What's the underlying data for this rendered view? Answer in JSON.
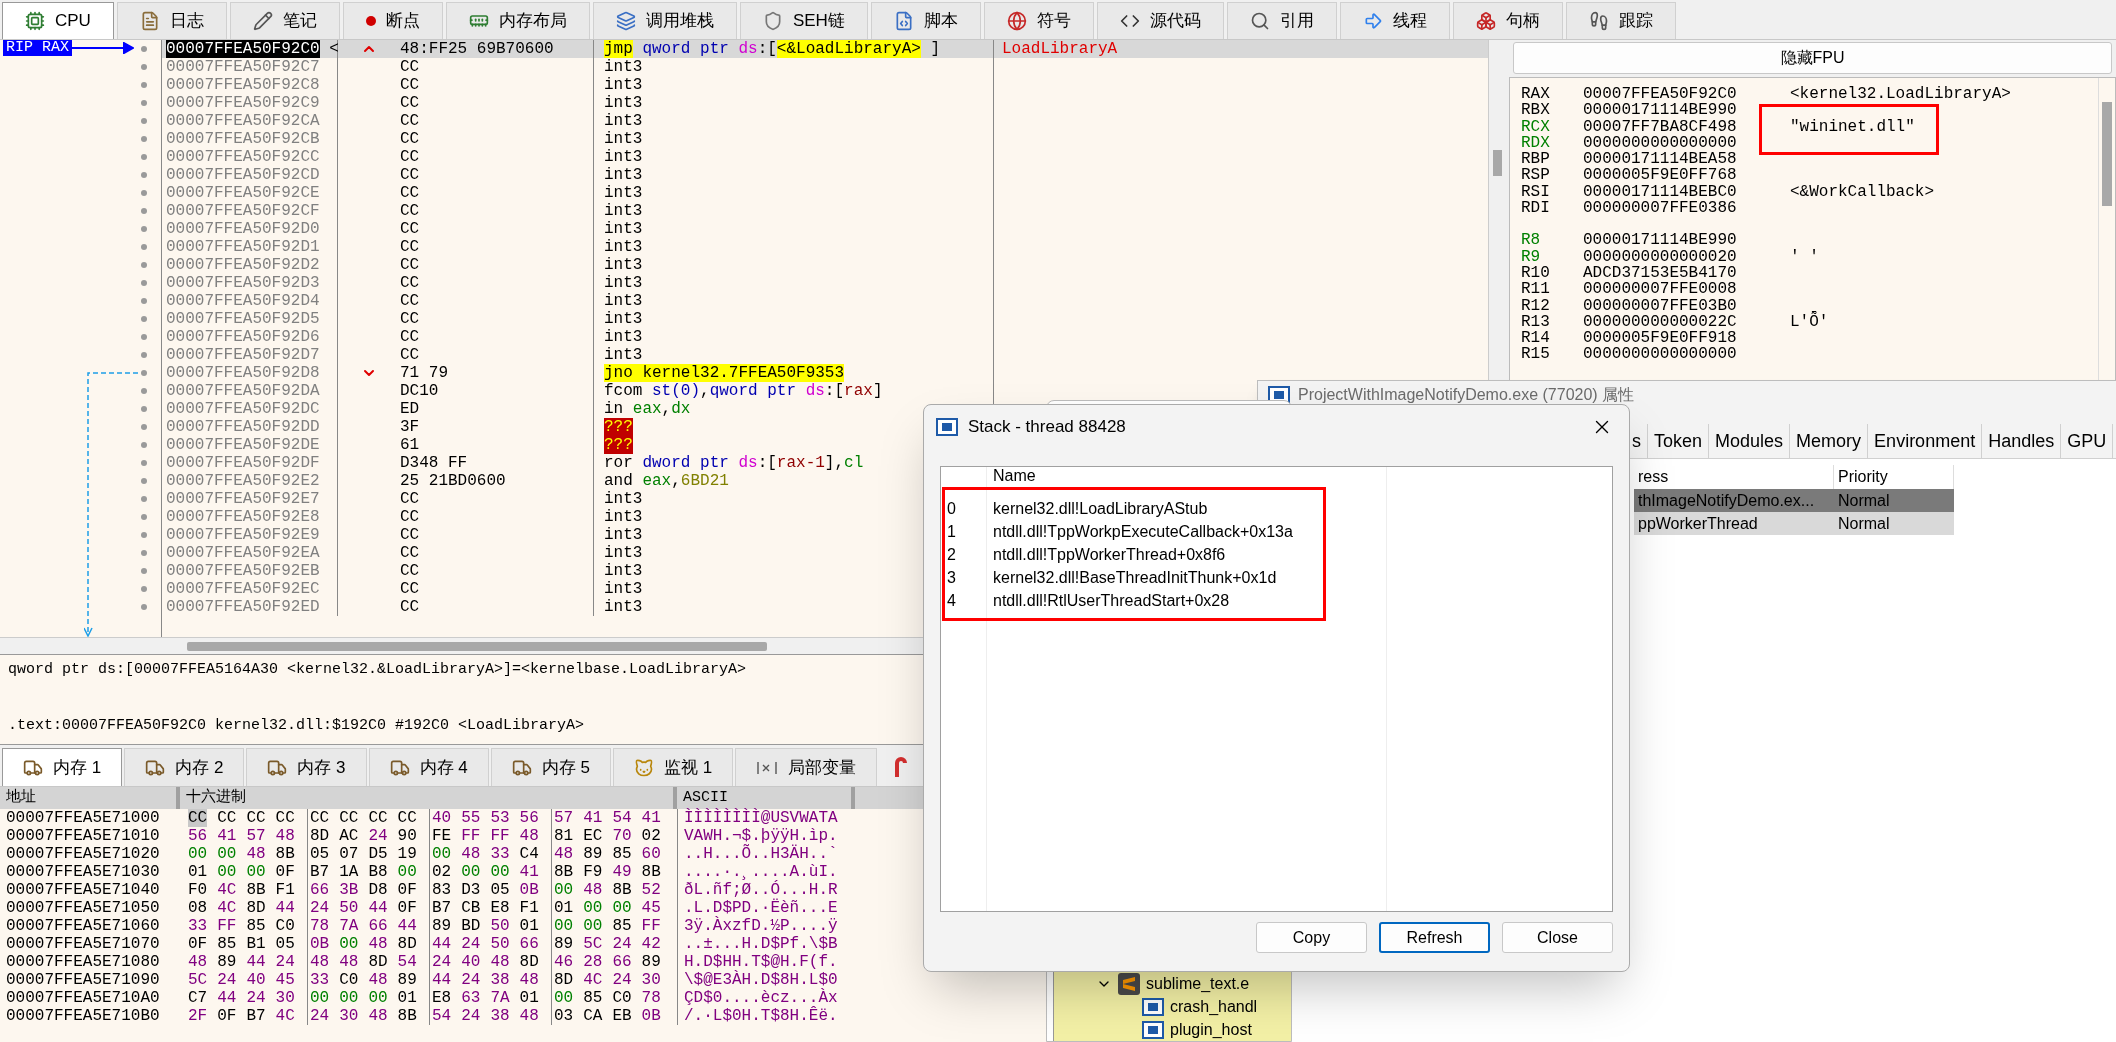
{
  "tabs": [
    {
      "label": "CPU",
      "selected": true
    },
    {
      "label": "日志",
      "selected": false
    },
    {
      "label": "笔记",
      "selected": false
    },
    {
      "label": "断点",
      "selected": false
    },
    {
      "label": "内存布局",
      "selected": false
    },
    {
      "label": "调用堆栈",
      "selected": false
    },
    {
      "label": "SEH链",
      "selected": false
    },
    {
      "label": "脚本",
      "selected": false
    },
    {
      "label": "符号",
      "selected": false
    },
    {
      "label": "源代码",
      "selected": false
    },
    {
      "label": "引用",
      "selected": false
    },
    {
      "label": "线程",
      "selected": false
    },
    {
      "label": "句柄",
      "selected": false
    },
    {
      "label": "跟踪",
      "selected": false
    }
  ],
  "disassembly": {
    "rip_label": "RIP RAX",
    "rows": [
      {
        "address": "00007FFEA50F92C0",
        "label": "<",
        "selected": true,
        "kind": "up",
        "bytes": "48:FF25 69B70600",
        "tokens": [
          {
            "text": "jmp",
            "kind": "jump"
          },
          {
            "text": " qword ptr",
            "kind": "ptr"
          },
          {
            "text": " ds",
            "kind": "seg"
          },
          {
            "text": ":[",
            "kind": "plain"
          },
          {
            "text": "<&LoadLibraryA>",
            "kind": "sym"
          },
          {
            "text": " ]",
            "kind": "plain"
          }
        ],
        "comment": "LoadLibraryA"
      },
      {
        "address": "00007FFEA50F92C7",
        "selected": false,
        "kind": "plain",
        "bytes": "CC",
        "tokens": [
          {
            "text": "int3",
            "kind": "plain"
          }
        ]
      },
      {
        "address": "00007FFEA50F92C8",
        "selected": false,
        "kind": "plain",
        "bytes": "CC",
        "tokens": [
          {
            "text": "int3",
            "kind": "plain"
          }
        ]
      },
      {
        "address": "00007FFEA50F92C9",
        "selected": false,
        "kind": "plain",
        "bytes": "CC",
        "tokens": [
          {
            "text": "int3",
            "kind": "plain"
          }
        ]
      },
      {
        "address": "00007FFEA50F92CA",
        "selected": false,
        "kind": "plain",
        "bytes": "CC",
        "tokens": [
          {
            "text": "int3",
            "kind": "plain"
          }
        ]
      },
      {
        "address": "00007FFEA50F92CB",
        "selected": false,
        "kind": "plain",
        "bytes": "CC",
        "tokens": [
          {
            "text": "int3",
            "kind": "plain"
          }
        ]
      },
      {
        "address": "00007FFEA50F92CC",
        "selected": false,
        "kind": "plain",
        "bytes": "CC",
        "tokens": [
          {
            "text": "int3",
            "kind": "plain"
          }
        ]
      },
      {
        "address": "00007FFEA50F92CD",
        "selected": false,
        "kind": "plain",
        "bytes": "CC",
        "tokens": [
          {
            "text": "int3",
            "kind": "plain"
          }
        ]
      },
      {
        "address": "00007FFEA50F92CE",
        "selected": false,
        "kind": "plain",
        "bytes": "CC",
        "tokens": [
          {
            "text": "int3",
            "kind": "plain"
          }
        ]
      },
      {
        "address": "00007FFEA50F92CF",
        "selected": false,
        "kind": "plain",
        "bytes": "CC",
        "tokens": [
          {
            "text": "int3",
            "kind": "plain"
          }
        ]
      },
      {
        "address": "00007FFEA50F92D0",
        "selected": false,
        "kind": "plain",
        "bytes": "CC",
        "tokens": [
          {
            "text": "int3",
            "kind": "plain"
          }
        ]
      },
      {
        "address": "00007FFEA50F92D1",
        "selected": false,
        "kind": "plain",
        "bytes": "CC",
        "tokens": [
          {
            "text": "int3",
            "kind": "plain"
          }
        ]
      },
      {
        "address": "00007FFEA50F92D2",
        "selected": false,
        "kind": "plain",
        "bytes": "CC",
        "tokens": [
          {
            "text": "int3",
            "kind": "plain"
          }
        ]
      },
      {
        "address": "00007FFEA50F92D3",
        "selected": false,
        "kind": "plain",
        "bytes": "CC",
        "tokens": [
          {
            "text": "int3",
            "kind": "plain"
          }
        ]
      },
      {
        "address": "00007FFEA50F92D4",
        "selected": false,
        "kind": "plain",
        "bytes": "CC",
        "tokens": [
          {
            "text": "int3",
            "kind": "plain"
          }
        ]
      },
      {
        "address": "00007FFEA50F92D5",
        "selected": false,
        "kind": "plain",
        "bytes": "CC",
        "tokens": [
          {
            "text": "int3",
            "kind": "plain"
          }
        ]
      },
      {
        "address": "00007FFEA50F92D6",
        "selected": false,
        "kind": "plain",
        "bytes": "CC",
        "tokens": [
          {
            "text": "int3",
            "kind": "plain"
          }
        ]
      },
      {
        "address": "00007FFEA50F92D7",
        "selected": false,
        "kind": "plain",
        "bytes": "CC",
        "tokens": [
          {
            "text": "int3",
            "kind": "plain"
          }
        ]
      },
      {
        "address": "00007FFEA50F92D8",
        "selected": false,
        "kind": "down",
        "bytes": "71 79",
        "tokens": [
          {
            "text": "jno",
            "kind": "jump"
          },
          {
            "text": " kernel32.7FFEA50F9353",
            "kind": "sym"
          }
        ]
      },
      {
        "address": "00007FFEA50F92DA",
        "selected": false,
        "kind": "plain",
        "bytes": "DC10",
        "tokens": [
          {
            "text": "fcom",
            "kind": "plain"
          },
          {
            "text": " st(0)",
            "kind": "ptr"
          },
          {
            "text": ",",
            "kind": "plain"
          },
          {
            "text": "qword ptr",
            "kind": "ptr"
          },
          {
            "text": " ds",
            "kind": "seg"
          },
          {
            "text": ":[",
            "kind": "plain"
          },
          {
            "text": "rax",
            "kind": "mem"
          },
          {
            "text": "]",
            "kind": "plain"
          }
        ]
      },
      {
        "address": "00007FFEA50F92DC",
        "selected": false,
        "kind": "plain",
        "bytes": "ED",
        "tokens": [
          {
            "text": "in",
            "kind": "plain"
          },
          {
            "text": " eax",
            "kind": "reg"
          },
          {
            "text": ",",
            "kind": "plain"
          },
          {
            "text": "dx",
            "kind": "reg"
          }
        ]
      },
      {
        "address": "00007FFEA50F92DD",
        "selected": false,
        "kind": "plain",
        "bytes": "3F",
        "tokens": [
          {
            "text": "???",
            "kind": "bad"
          }
        ]
      },
      {
        "address": "00007FFEA50F92DE",
        "selected": false,
        "kind": "plain",
        "bytes": "61",
        "tokens": [
          {
            "text": "???",
            "kind": "bad"
          }
        ]
      },
      {
        "address": "00007FFEA50F92DF",
        "selected": false,
        "kind": "plain",
        "bytes": "D348 FF",
        "tokens": [
          {
            "text": "ror",
            "kind": "plain"
          },
          {
            "text": " dword ptr",
            "kind": "ptr"
          },
          {
            "text": " ds",
            "kind": "seg"
          },
          {
            "text": ":[",
            "kind": "plain"
          },
          {
            "text": "rax-1",
            "kind": "mem"
          },
          {
            "text": "],",
            "kind": "plain"
          },
          {
            "text": "cl",
            "kind": "reg"
          }
        ]
      },
      {
        "address": "00007FFEA50F92E2",
        "selected": false,
        "kind": "plain",
        "bytes": "25 21BD0600",
        "tokens": [
          {
            "text": "and",
            "kind": "plain"
          },
          {
            "text": " eax",
            "kind": "reg"
          },
          {
            "text": ",",
            "kind": "plain"
          },
          {
            "text": "6BD21",
            "kind": "imm"
          }
        ]
      },
      {
        "address": "00007FFEA50F92E7",
        "selected": false,
        "kind": "plain",
        "bytes": "CC",
        "tokens": [
          {
            "text": "int3",
            "kind": "plain"
          }
        ]
      },
      {
        "address": "00007FFEA50F92E8",
        "selected": false,
        "kind": "plain",
        "bytes": "CC",
        "tokens": [
          {
            "text": "int3",
            "kind": "plain"
          }
        ]
      },
      {
        "address": "00007FFEA50F92E9",
        "selected": false,
        "kind": "plain",
        "bytes": "CC",
        "tokens": [
          {
            "text": "int3",
            "kind": "plain"
          }
        ]
      },
      {
        "address": "00007FFEA50F92EA",
        "selected": false,
        "kind": "plain",
        "bytes": "CC",
        "tokens": [
          {
            "text": "int3",
            "kind": "plain"
          }
        ]
      },
      {
        "address": "00007FFEA50F92EB",
        "selected": false,
        "kind": "plain",
        "bytes": "CC",
        "tokens": [
          {
            "text": "int3",
            "kind": "plain"
          }
        ]
      },
      {
        "address": "00007FFEA50F92EC",
        "selected": false,
        "kind": "plain",
        "bytes": "CC",
        "tokens": [
          {
            "text": "int3",
            "kind": "plain"
          }
        ]
      },
      {
        "address": "00007FFEA50F92ED",
        "selected": false,
        "kind": "plain",
        "bytes": "CC",
        "tokens": [
          {
            "text": "int3",
            "kind": "plain"
          }
        ]
      }
    ]
  },
  "info": {
    "lines": [
      "qword ptr ds:[00007FFEA5164A30 <kernel32.&LoadLibraryA>]=<kernelbase.LoadLibraryA>",
      ".text:00007FFEA50F92C0 kernel32.dll:$192C0 #192C0 <LoadLibraryA>"
    ]
  },
  "memory_tabs": [
    {
      "label": "内存 1",
      "selected": true
    },
    {
      "label": "内存 2",
      "selected": false
    },
    {
      "label": "内存 3",
      "selected": false
    },
    {
      "label": "内存 4",
      "selected": false
    },
    {
      "label": "内存 5",
      "selected": false
    },
    {
      "label": "监视 1",
      "selected": false
    },
    {
      "label": "局部变量",
      "selected": false
    }
  ],
  "hex": {
    "columns": [
      "地址",
      "十六进制",
      "ASCII"
    ],
    "rows": [
      {
        "address": "00007FFEA5E71000",
        "bytes": [
          {
            "text": "CC",
            "kind": "other"
          },
          {
            "text": "CC",
            "kind": "other"
          },
          {
            "text": "CC",
            "kind": "other"
          },
          {
            "text": "CC",
            "kind": "other"
          },
          {
            "text": "CC",
            "kind": "other"
          },
          {
            "text": "CC",
            "kind": "other"
          },
          {
            "text": "CC",
            "kind": "other"
          },
          {
            "text": "CC",
            "kind": "other"
          },
          {
            "text": "40",
            "kind": "ascii"
          },
          {
            "text": "55",
            "kind": "ascii"
          },
          {
            "text": "53",
            "kind": "ascii"
          },
          {
            "text": "56",
            "kind": "ascii"
          },
          {
            "text": "57",
            "kind": "ascii"
          },
          {
            "text": "41",
            "kind": "ascii"
          },
          {
            "text": "54",
            "kind": "ascii"
          },
          {
            "text": "41",
            "kind": "ascii"
          }
        ],
        "ascii": "ÌÌÌÌÌÌÌÌ@USVWATA"
      },
      {
        "address": "00007FFEA5E71010",
        "bytes": [
          {
            "text": "56",
            "kind": "ascii"
          },
          {
            "text": "41",
            "kind": "ascii"
          },
          {
            "text": "57",
            "kind": "ascii"
          },
          {
            "text": "48",
            "kind": "ascii"
          },
          {
            "text": "8D",
            "kind": "other"
          },
          {
            "text": "AC",
            "kind": "other"
          },
          {
            "text": "24",
            "kind": "ascii"
          },
          {
            "text": "90",
            "kind": "other"
          },
          {
            "text": "FE",
            "kind": "other"
          },
          {
            "text": "FF",
            "kind": "ascii"
          },
          {
            "text": "FF",
            "kind": "ascii"
          },
          {
            "text": "48",
            "kind": "ascii"
          },
          {
            "text": "81",
            "kind": "other"
          },
          {
            "text": "EC",
            "kind": "other"
          },
          {
            "text": "70",
            "kind": "ascii"
          },
          {
            "text": "02",
            "kind": "other"
          }
        ],
        "ascii": "VAWH.¬$.þÿÿH.ìp."
      },
      {
        "address": "00007FFEA5E71020",
        "bytes": [
          {
            "text": "00",
            "kind": "zero"
          },
          {
            "text": "00",
            "kind": "zero"
          },
          {
            "text": "48",
            "kind": "ascii"
          },
          {
            "text": "8B",
            "kind": "other"
          },
          {
            "text": "05",
            "kind": "other"
          },
          {
            "text": "07",
            "kind": "other"
          },
          {
            "text": "D5",
            "kind": "other"
          },
          {
            "text": "19",
            "kind": "other"
          },
          {
            "text": "00",
            "kind": "zero"
          },
          {
            "text": "48",
            "kind": "ascii"
          },
          {
            "text": "33",
            "kind": "ascii"
          },
          {
            "text": "C4",
            "kind": "other"
          },
          {
            "text": "48",
            "kind": "ascii"
          },
          {
            "text": "89",
            "kind": "other"
          },
          {
            "text": "85",
            "kind": "other"
          },
          {
            "text": "60",
            "kind": "ascii"
          }
        ],
        "ascii": "..H...Õ..H3ÄH..`"
      },
      {
        "address": "00007FFEA5E71030",
        "bytes": [
          {
            "text": "01",
            "kind": "other"
          },
          {
            "text": "00",
            "kind": "zero"
          },
          {
            "text": "00",
            "kind": "zero"
          },
          {
            "text": "0F",
            "kind": "other"
          },
          {
            "text": "B7",
            "kind": "other"
          },
          {
            "text": "1A",
            "kind": "other"
          },
          {
            "text": "B8",
            "kind": "other"
          },
          {
            "text": "00",
            "kind": "zero"
          },
          {
            "text": "02",
            "kind": "other"
          },
          {
            "text": "00",
            "kind": "zero"
          },
          {
            "text": "00",
            "kind": "zero"
          },
          {
            "text": "41",
            "kind": "ascii"
          },
          {
            "text": "8B",
            "kind": "other"
          },
          {
            "text": "F9",
            "kind": "other"
          },
          {
            "text": "49",
            "kind": "ascii"
          },
          {
            "text": "8B",
            "kind": "other"
          }
        ],
        "ascii": "....·.¸....A.ùI."
      },
      {
        "address": "00007FFEA5E71040",
        "bytes": [
          {
            "text": "F0",
            "kind": "other"
          },
          {
            "text": "4C",
            "kind": "ascii"
          },
          {
            "text": "8B",
            "kind": "other"
          },
          {
            "text": "F1",
            "kind": "other"
          },
          {
            "text": "66",
            "kind": "ascii"
          },
          {
            "text": "3B",
            "kind": "ascii"
          },
          {
            "text": "D8",
            "kind": "other"
          },
          {
            "text": "0F",
            "kind": "other"
          },
          {
            "text": "83",
            "kind": "other"
          },
          {
            "text": "D3",
            "kind": "other"
          },
          {
            "text": "05",
            "kind": "other"
          },
          {
            "text": "0B",
            "kind": "ascii"
          },
          {
            "text": "00",
            "kind": "zero"
          },
          {
            "text": "48",
            "kind": "ascii"
          },
          {
            "text": "8B",
            "kind": "other"
          },
          {
            "text": "52",
            "kind": "ascii"
          }
        ],
        "ascii": "ðL.ñf;Ø..Ó...H.R"
      },
      {
        "address": "00007FFEA5E71050",
        "bytes": [
          {
            "text": "08",
            "kind": "other"
          },
          {
            "text": "4C",
            "kind": "ascii"
          },
          {
            "text": "8D",
            "kind": "other"
          },
          {
            "text": "44",
            "kind": "ascii"
          },
          {
            "text": "24",
            "kind": "ascii"
          },
          {
            "text": "50",
            "kind": "ascii"
          },
          {
            "text": "44",
            "kind": "ascii"
          },
          {
            "text": "0F",
            "kind": "other"
          },
          {
            "text": "B7",
            "kind": "other"
          },
          {
            "text": "CB",
            "kind": "other"
          },
          {
            "text": "E8",
            "kind": "other"
          },
          {
            "text": "F1",
            "kind": "other"
          },
          {
            "text": "01",
            "kind": "other"
          },
          {
            "text": "00",
            "kind": "zero"
          },
          {
            "text": "00",
            "kind": "zero"
          },
          {
            "text": "45",
            "kind": "ascii"
          }
        ],
        "ascii": ".L.D$PD.·Ëèñ...E"
      },
      {
        "address": "00007FFEA5E71060",
        "bytes": [
          {
            "text": "33",
            "kind": "ascii"
          },
          {
            "text": "FF",
            "kind": "ascii"
          },
          {
            "text": "85",
            "kind": "other"
          },
          {
            "text": "C0",
            "kind": "other"
          },
          {
            "text": "78",
            "kind": "ascii"
          },
          {
            "text": "7A",
            "kind": "ascii"
          },
          {
            "text": "66",
            "kind": "ascii"
          },
          {
            "text": "44",
            "kind": "ascii"
          },
          {
            "text": "89",
            "kind": "other"
          },
          {
            "text": "BD",
            "kind": "other"
          },
          {
            "text": "50",
            "kind": "ascii"
          },
          {
            "text": "01",
            "kind": "other"
          },
          {
            "text": "00",
            "kind": "zero"
          },
          {
            "text": "00",
            "kind": "zero"
          },
          {
            "text": "85",
            "kind": "other"
          },
          {
            "text": "FF",
            "kind": "ascii"
          }
        ],
        "ascii": "3ÿ.ÀxzfD.½P....ÿ"
      },
      {
        "address": "00007FFEA5E71070",
        "bytes": [
          {
            "text": "0F",
            "kind": "other"
          },
          {
            "text": "85",
            "kind": "other"
          },
          {
            "text": "B1",
            "kind": "other"
          },
          {
            "text": "05",
            "kind": "other"
          },
          {
            "text": "0B",
            "kind": "ascii"
          },
          {
            "text": "00",
            "kind": "zero"
          },
          {
            "text": "48",
            "kind": "ascii"
          },
          {
            "text": "8D",
            "kind": "other"
          },
          {
            "text": "44",
            "kind": "ascii"
          },
          {
            "text": "24",
            "kind": "ascii"
          },
          {
            "text": "50",
            "kind": "ascii"
          },
          {
            "text": "66",
            "kind": "ascii"
          },
          {
            "text": "89",
            "kind": "other"
          },
          {
            "text": "5C",
            "kind": "ascii"
          },
          {
            "text": "24",
            "kind": "ascii"
          },
          {
            "text": "42",
            "kind": "ascii"
          }
        ],
        "ascii": "..±...H.D$Pf.\\$B"
      },
      {
        "address": "00007FFEA5E71080",
        "bytes": [
          {
            "text": "48",
            "kind": "ascii"
          },
          {
            "text": "89",
            "kind": "other"
          },
          {
            "text": "44",
            "kind": "ascii"
          },
          {
            "text": "24",
            "kind": "ascii"
          },
          {
            "text": "48",
            "kind": "ascii"
          },
          {
            "text": "48",
            "kind": "ascii"
          },
          {
            "text": "8D",
            "kind": "other"
          },
          {
            "text": "54",
            "kind": "ascii"
          },
          {
            "text": "24",
            "kind": "ascii"
          },
          {
            "text": "40",
            "kind": "ascii"
          },
          {
            "text": "48",
            "kind": "ascii"
          },
          {
            "text": "8D",
            "kind": "other"
          },
          {
            "text": "46",
            "kind": "ascii"
          },
          {
            "text": "28",
            "kind": "ascii"
          },
          {
            "text": "66",
            "kind": "ascii"
          },
          {
            "text": "89",
            "kind": "other"
          }
        ],
        "ascii": "H.D$HH.T$@H.F(f."
      },
      {
        "address": "00007FFEA5E71090",
        "bytes": [
          {
            "text": "5C",
            "kind": "ascii"
          },
          {
            "text": "24",
            "kind": "ascii"
          },
          {
            "text": "40",
            "kind": "ascii"
          },
          {
            "text": "45",
            "kind": "ascii"
          },
          {
            "text": "33",
            "kind": "ascii"
          },
          {
            "text": "C0",
            "kind": "other"
          },
          {
            "text": "48",
            "kind": "ascii"
          },
          {
            "text": "89",
            "kind": "other"
          },
          {
            "text": "44",
            "kind": "ascii"
          },
          {
            "text": "24",
            "kind": "ascii"
          },
          {
            "text": "38",
            "kind": "ascii"
          },
          {
            "text": "48",
            "kind": "ascii"
          },
          {
            "text": "8D",
            "kind": "other"
          },
          {
            "text": "4C",
            "kind": "ascii"
          },
          {
            "text": "24",
            "kind": "ascii"
          },
          {
            "text": "30",
            "kind": "ascii"
          }
        ],
        "ascii": "\\$@E3ÀH.D$8H.L$0"
      },
      {
        "address": "00007FFEA5E710A0",
        "bytes": [
          {
            "text": "C7",
            "kind": "other"
          },
          {
            "text": "44",
            "kind": "ascii"
          },
          {
            "text": "24",
            "kind": "ascii"
          },
          {
            "text": "30",
            "kind": "ascii"
          },
          {
            "text": "00",
            "kind": "zero"
          },
          {
            "text": "00",
            "kind": "zero"
          },
          {
            "text": "00",
            "kind": "zero"
          },
          {
            "text": "01",
            "kind": "other"
          },
          {
            "text": "E8",
            "kind": "other"
          },
          {
            "text": "63",
            "kind": "ascii"
          },
          {
            "text": "7A",
            "kind": "ascii"
          },
          {
            "text": "01",
            "kind": "other"
          },
          {
            "text": "00",
            "kind": "zero"
          },
          {
            "text": "85",
            "kind": "other"
          },
          {
            "text": "C0",
            "kind": "other"
          },
          {
            "text": "78",
            "kind": "ascii"
          }
        ],
        "ascii": "ÇD$0....ècz...Àx"
      },
      {
        "address": "00007FFEA5E710B0",
        "bytes": [
          {
            "text": "2F",
            "kind": "ascii"
          },
          {
            "text": "0F",
            "kind": "other"
          },
          {
            "text": "B7",
            "kind": "other"
          },
          {
            "text": "4C",
            "kind": "ascii"
          },
          {
            "text": "24",
            "kind": "ascii"
          },
          {
            "text": "30",
            "kind": "ascii"
          },
          {
            "text": "48",
            "kind": "ascii"
          },
          {
            "text": "8B",
            "kind": "other"
          },
          {
            "text": "54",
            "kind": "ascii"
          },
          {
            "text": "24",
            "kind": "ascii"
          },
          {
            "text": "38",
            "kind": "ascii"
          },
          {
            "text": "48",
            "kind": "ascii"
          },
          {
            "text": "03",
            "kind": "other"
          },
          {
            "text": "CA",
            "kind": "other"
          },
          {
            "text": "EB",
            "kind": "other"
          },
          {
            "text": "0B",
            "kind": "ascii"
          }
        ],
        "ascii": "/.·L$0H.T$8H.Êë."
      }
    ]
  },
  "registers": {
    "button": "隐藏FPU",
    "groups": [
      [
        {
          "name": "RAX",
          "value": "00007FFEA50F92C0",
          "comment": "<kernel32.LoadLibraryA>",
          "changed": false
        },
        {
          "name": "RBX",
          "value": "00000171114BE990",
          "changed": false
        },
        {
          "name": "RCX",
          "value": "00007FF7BA8CF498",
          "comment": "\"wininet.dll\"",
          "changed": true
        },
        {
          "name": "RDX",
          "value": "0000000000000000",
          "changed": true
        },
        {
          "name": "RBP",
          "value": "00000171114BEA58",
          "changed": false
        },
        {
          "name": "RSP",
          "value": "0000005F9E0FF768",
          "changed": false
        },
        {
          "name": "RSI",
          "value": "00000171114BEBC0",
          "comment": "<&WorkCallback>",
          "changed": false
        },
        {
          "name": "RDI",
          "value": "000000007FFE0386",
          "changed": false
        }
      ],
      [
        {
          "name": "R8",
          "value": "00000171114BE990",
          "changed": true
        },
        {
          "name": "R9",
          "value": "0000000000000020",
          "comment": "' '",
          "changed": true
        },
        {
          "name": "R10",
          "value": "ADCD37153E5B4170",
          "changed": false
        },
        {
          "name": "R11",
          "value": "000000007FFE0008",
          "changed": false
        },
        {
          "name": "R12",
          "value": "000000007FFE03B0",
          "changed": false
        },
        {
          "name": "R13",
          "value": "000000000000022C",
          "comment": "L'Ȭ'",
          "changed": false
        },
        {
          "name": "R14",
          "value": "0000005F9E0FF918",
          "changed": false
        },
        {
          "name": "R15",
          "value": "0000000000000000",
          "changed": false
        }
      ]
    ]
  },
  "properties_window": {
    "title": "ProjectWithImageNotifyDemo.exe (77020) 属性",
    "tabs": [
      {
        "label": "s",
        "selected": false
      },
      {
        "label": "Token",
        "selected": false
      },
      {
        "label": "Modules",
        "selected": false
      },
      {
        "label": "Memory",
        "selected": false
      },
      {
        "label": "Environment",
        "selected": false
      },
      {
        "label": "Handles",
        "selected": false
      },
      {
        "label": "GPU",
        "selected": false
      }
    ],
    "columns": [
      "ress",
      "Priority"
    ],
    "rows": [
      {
        "cells": [
          "thImageNotifyDemo.ex...",
          "Normal"
        ],
        "selected": true
      },
      {
        "cells": [
          "ppWorkerThread",
          "Normal"
        ],
        "selected": false
      }
    ]
  },
  "process_tree": {
    "items": [
      {
        "name": "sublime_text.e",
        "expanded": true,
        "children": [
          {
            "name": "crash_handl"
          },
          {
            "name": "plugin_host"
          }
        ]
      }
    ]
  },
  "stack_dialog": {
    "title": "Stack - thread 88428",
    "columns": [
      "Name"
    ],
    "frames": [
      {
        "index": "0",
        "name": "kernel32.dll!LoadLibraryAStub"
      },
      {
        "index": "1",
        "name": "ntdll.dll!TppWorkpExecuteCallback+0x13a"
      },
      {
        "index": "2",
        "name": "ntdll.dll!TppWorkerThread+0x8f6"
      },
      {
        "index": "3",
        "name": "kernel32.dll!BaseThreadInitThunk+0x1d"
      },
      {
        "index": "4",
        "name": "ntdll.dll!RtlUserThreadStart+0x28"
      }
    ],
    "buttons": [
      {
        "label": "Copy",
        "focused": false
      },
      {
        "label": "Refresh",
        "focused": true
      },
      {
        "label": "Close",
        "focused": false
      }
    ]
  }
}
